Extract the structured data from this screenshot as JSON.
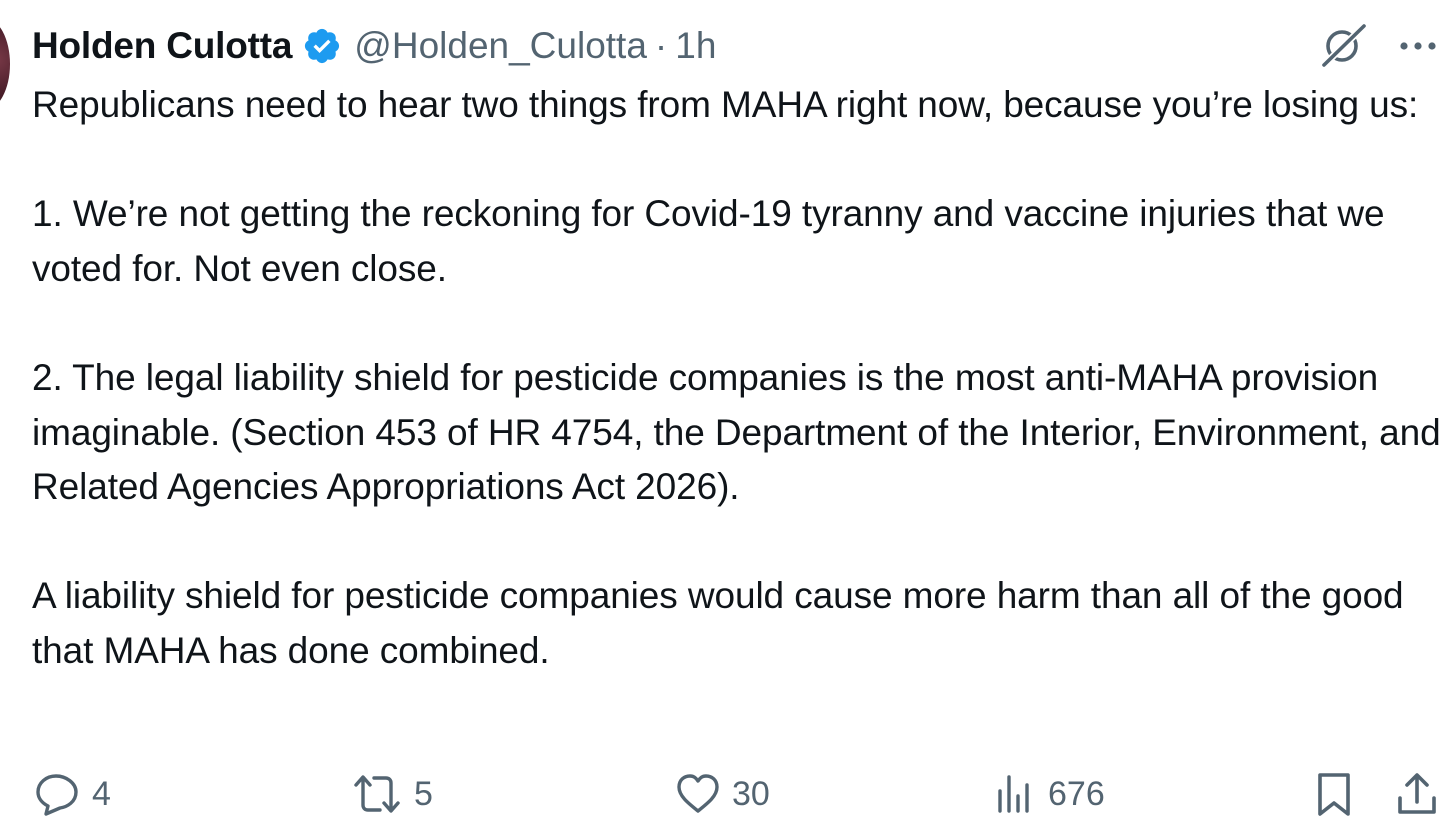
{
  "tweet": {
    "author": {
      "name": "Holden Culotta",
      "handle": "@Holden_Culotta",
      "verified": true
    },
    "separator": "·",
    "time": "1h",
    "text": "Republicans need to hear two things from MAHA right now, because you’re losing us:\n\n1. We’re not getting the reckoning for Covid-19 tyranny and vaccine injuries that we voted for. Not even close.\n\n2. The legal liability shield for pesticide companies is the most anti-MAHA provision imaginable. (Section 453 of HR 4754, the Department of the Interior, Environment, and Related Agencies Appropriations Act 2026).\n\nA liability shield for pesticide companies would cause more harm than all of the good that MAHA has done combined."
  },
  "actions": {
    "replies": "4",
    "reposts": "5",
    "likes": "30",
    "views": "676"
  },
  "icons": {
    "verified": "verified-badge-icon",
    "grok": "grok-icon",
    "more": "more-icon",
    "reply": "reply-icon",
    "repost": "repost-icon",
    "like": "heart-icon",
    "views": "views-icon",
    "bookmark": "bookmark-icon",
    "share": "share-icon"
  },
  "colors": {
    "text": "#0f1419",
    "secondary": "#536471",
    "verified": "#1d9bf0"
  }
}
